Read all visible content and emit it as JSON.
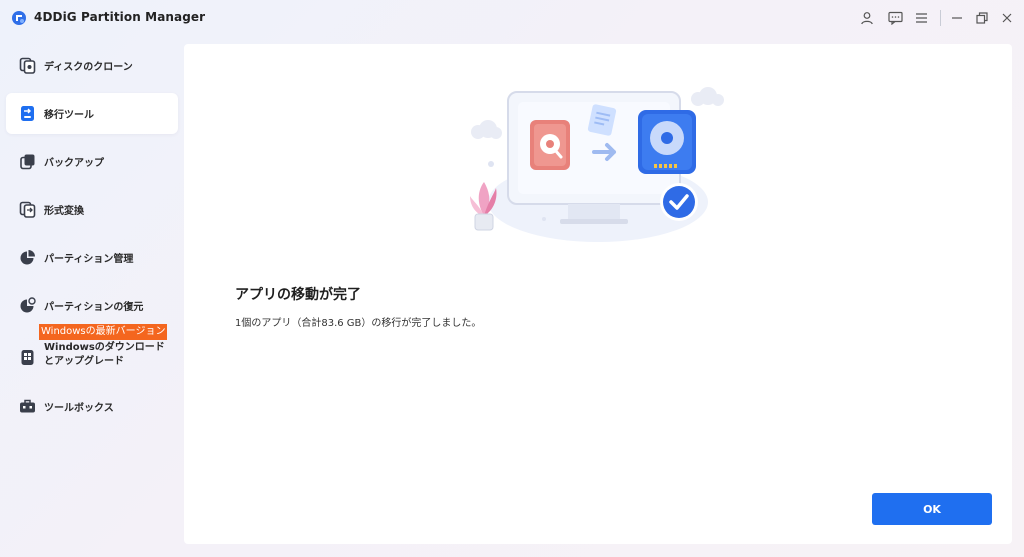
{
  "app": {
    "title": "4DDiG Partition Manager"
  },
  "titlebar": {
    "icons": [
      "account-icon",
      "feedback-icon",
      "menu-icon",
      "minimize-icon",
      "restore-icon",
      "close-icon"
    ]
  },
  "sidebar": {
    "items": [
      {
        "label": "ディスクのクローン",
        "icon": "disk-clone-icon",
        "active": false
      },
      {
        "label": "移行ツール",
        "icon": "migration-tool-icon",
        "active": true
      },
      {
        "label": "バックアップ",
        "icon": "backup-icon",
        "active": false
      },
      {
        "label": "形式変換",
        "icon": "format-convert-icon",
        "active": false
      },
      {
        "label": "パーティション管理",
        "icon": "pie-chart-icon",
        "active": false
      },
      {
        "label": "パーティションの復元",
        "icon": "partition-restore-icon",
        "active": false
      },
      {
        "label": "Windowsのダウンロードとアップグレード",
        "icon": "windows-download-icon",
        "active": false
      },
      {
        "label": "ツールボックス",
        "icon": "toolbox-icon",
        "active": false
      }
    ],
    "badge": "Windowsの最新バージョン"
  },
  "main": {
    "title": "アプリの移動が完了",
    "description": "1個のアプリ（合計83.6 GB）の移行が完了しました。",
    "ok_label": "OK"
  },
  "colors": {
    "accent": "#1f6ff0",
    "badge": "#f4661f",
    "active_bg": "#ffffff"
  }
}
